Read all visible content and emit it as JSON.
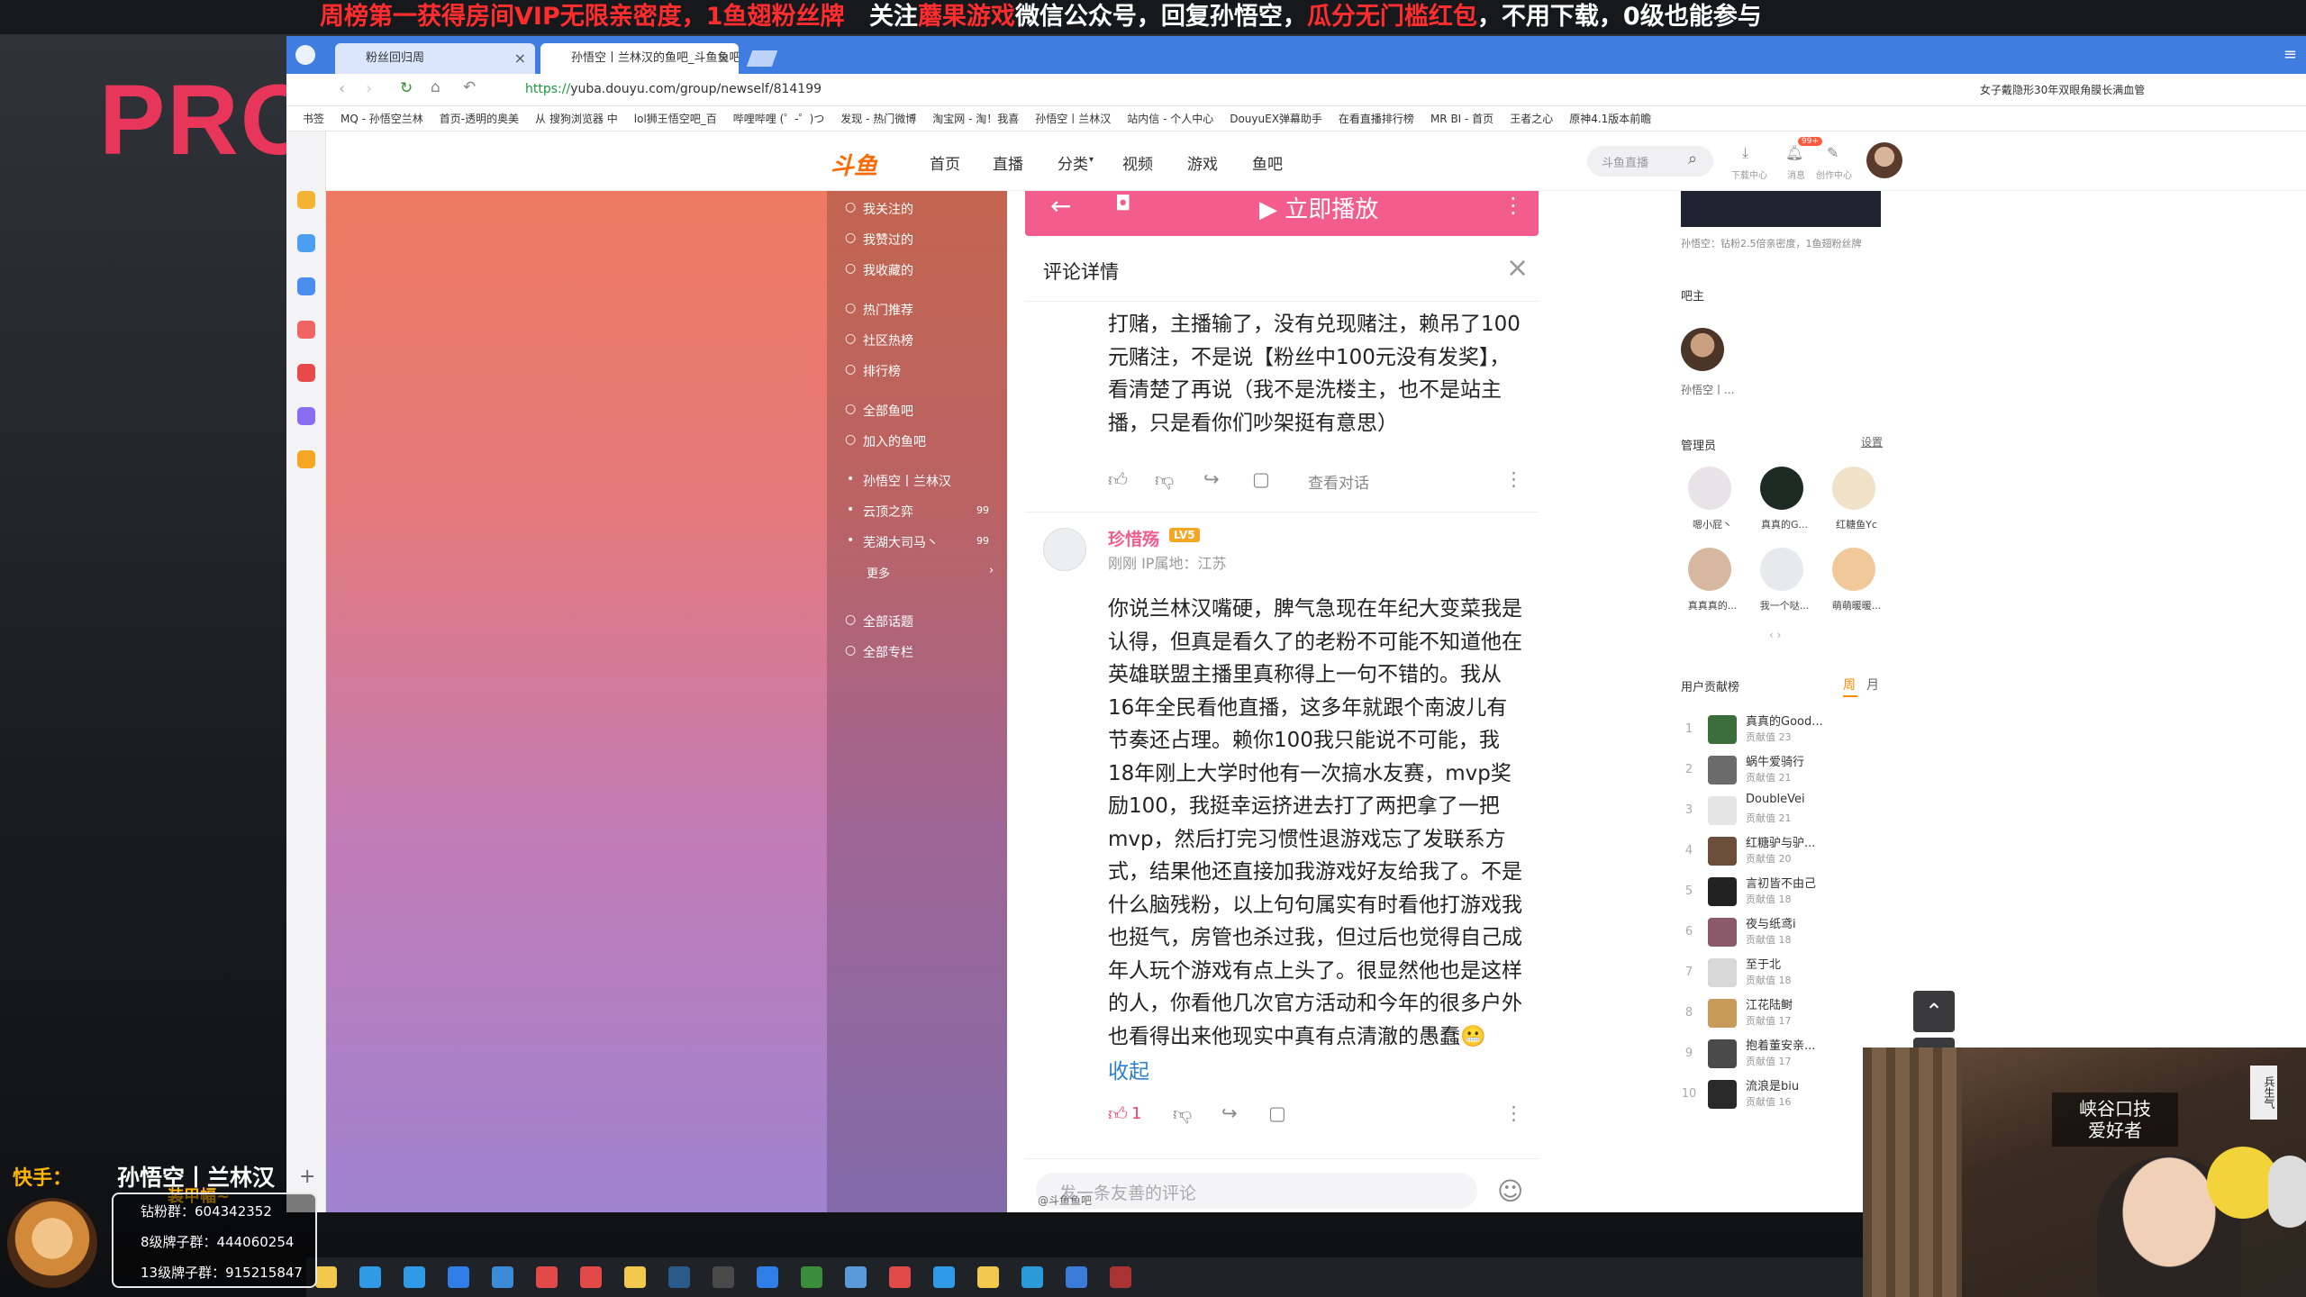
{
  "banner": {
    "part1": "周榜第一获得房间VIP无限亲密度，1鱼翅粉丝牌",
    "part2": "关注",
    "part3": "蘑果游戏",
    "part4": "微信公众号，回复孙悟空，",
    "part5": "瓜分无门槛红包",
    "part6": "，不用下载，0级也能参与"
  },
  "overlay_brand": "PROP",
  "browser": {
    "tabs": [
      {
        "label": "粉丝回归周",
        "close": "×"
      },
      {
        "label": "孙悟空丨兰林汉的鱼吧_斗鱼鱼吧",
        "close": "×"
      }
    ],
    "url": {
      "scheme": "https://",
      "rest": "yuba.douyu.com/group/newself/814199"
    },
    "url_right_text": "女子戴隐形30年双眼角膜长满血管",
    "bookmarks": [
      "书签",
      "MQ - 孙悟空兰林",
      "首页-透明的奥美",
      "从 搜狗浏览器 中",
      "lol狮王悟空吧_百",
      "哔哩哔哩 (゜-゜)つ",
      "发现 - 热门微博",
      "淘宝网 - 淘！我喜",
      "孙悟空丨兰林汉",
      "站内信 - 个人中心",
      "DouyuEX弹幕助手",
      "在看直播排行榜",
      "MR BI - 首页",
      "王者之心",
      "原神4.1版本前瞻"
    ]
  },
  "site": {
    "logo": "斗鱼",
    "nav": [
      "首页",
      "直播",
      "分类",
      "视频",
      "游戏",
      "鱼吧"
    ],
    "search_placeholder": "斗鱼直播",
    "header_icons": {
      "download": "下载中心",
      "message": "消息",
      "creator": "创作中心",
      "badge": "99+"
    }
  },
  "sidebar": {
    "items": [
      {
        "label": "我关注的",
        "icon": "heart-icon"
      },
      {
        "label": "我赞过的",
        "icon": "thumb-icon"
      },
      {
        "label": "我收藏的",
        "icon": "star-icon"
      },
      {
        "label": "热门推荐",
        "icon": "fire-icon"
      },
      {
        "label": "社区热榜",
        "icon": "list-icon"
      },
      {
        "label": "排行榜",
        "icon": "trophy-icon"
      },
      {
        "label": "全部鱼吧",
        "icon": "grid-icon"
      },
      {
        "label": "加入的鱼吧",
        "icon": "bookmark-icon"
      }
    ],
    "groups": [
      {
        "label": "孙悟空丨兰林汉",
        "count": ""
      },
      {
        "label": "云顶之弈",
        "count": "99"
      },
      {
        "label": "芜湖大司马丶",
        "count": "99"
      }
    ],
    "more": "更多",
    "bottom": [
      {
        "label": "全部话题",
        "icon": "topic-icon"
      },
      {
        "label": "全部专栏",
        "icon": "column-icon"
      }
    ]
  },
  "post": {
    "play_label": "立即播放",
    "panel_title": "评论详情",
    "first_comment_text": "打赌，主播输了，没有兑现赌注，赖吊了100元赌注，不是说【粉丝中100元没有发奖】，看清楚了再说（我不是洗楼主，也不是站主播，只是看你们吵架挺有意思）",
    "first_actions": {
      "view_dialog": "查看对话"
    },
    "reply": {
      "username": "珍惜殇",
      "level": "LV5",
      "meta": "刚刚  IP属地：江苏",
      "text": "你说兰林汉嘴硬，脾气急现在年纪大变菜我是认得，但真是看久了的老粉不可能不知道他在英雄联盟主播里真称得上一句不错的。我从16年全民看他直播，这多年就跟个南波儿有节奏还占理。赖你100我只能说不可能，我18年刚上大学时他有一次搞水友赛，mvp奖励100，我挺幸运挤进去打了两把拿了一把mvp，然后打完习惯性退游戏忘了发联系方式，结果他还直接加我游戏好友给我了。不是什么脑残粉，以上句句属实有时看他打游戏我也挺气，房管也杀过我，但过后也觉得自己成年人玩个游戏有点上头了。很显然他也是这样的人，你看他几次官方活动和今年的很多户外也看得出来他现实中真有点清澈的愚蠢",
      "emoji": "😬",
      "collapse": "收起",
      "like_count": "1"
    },
    "input_placeholder": "发一条友善的评论",
    "watermark": "@斗鱼鱼吧"
  },
  "right": {
    "top_caption": "孙悟空：钻粉2.5倍亲密度，1鱼翅粉丝牌",
    "bazhu": {
      "title": "吧主",
      "name": "孙悟空丨..."
    },
    "admins": {
      "title": "管理员",
      "settings": "设置",
      "people": [
        "嗯小屁丶",
        "真真的G...",
        "红糖鱼Yc",
        "真真真的...",
        "我一个哒...",
        "萌萌暖暖..."
      ]
    },
    "contrib": {
      "title": "用户贡献榜",
      "tab_week": "周",
      "tab_month": "月",
      "rows": [
        {
          "rank": "1",
          "name": "真真的Good...",
          "value": "贡献值 23"
        },
        {
          "rank": "2",
          "name": "蜗牛爱骑行",
          "value": "贡献值 21"
        },
        {
          "rank": "3",
          "name": "DoubleVei",
          "value": "贡献值 21"
        },
        {
          "rank": "4",
          "name": "红糖驴与驴...",
          "value": "贡献值 20"
        },
        {
          "rank": "5",
          "name": "言初皆不由己",
          "value": "贡献值 18"
        },
        {
          "rank": "6",
          "name": "夜与纸鸢i",
          "value": "贡献值 18"
        },
        {
          "rank": "7",
          "name": "至于北",
          "value": "贡献值 18"
        },
        {
          "rank": "8",
          "name": "江花陆鲥",
          "value": "贡献值 17"
        },
        {
          "rank": "9",
          "name": "抱着董安亲...",
          "value": "贡献值 17"
        },
        {
          "rank": "10",
          "name": "流浪是biu",
          "value": "贡献值 16"
        }
      ]
    }
  },
  "kuaishou": {
    "label": "快手：",
    "name": "孙悟空丨兰林汉",
    "sub": "装甲幅~",
    "lines": [
      "钻粉群：604342352",
      "8级牌子群：444060254",
      "13级牌子群：915215847"
    ]
  },
  "webcam": {
    "sign1": "峡谷口技",
    "sign2": "爱好者",
    "scroll": "兵生气"
  },
  "colors": {
    "accent_pink": "#f25d8e",
    "douyu_orange": "#ff6a00",
    "link_blue": "#2a7fd3",
    "like_red": "#f2416b"
  }
}
